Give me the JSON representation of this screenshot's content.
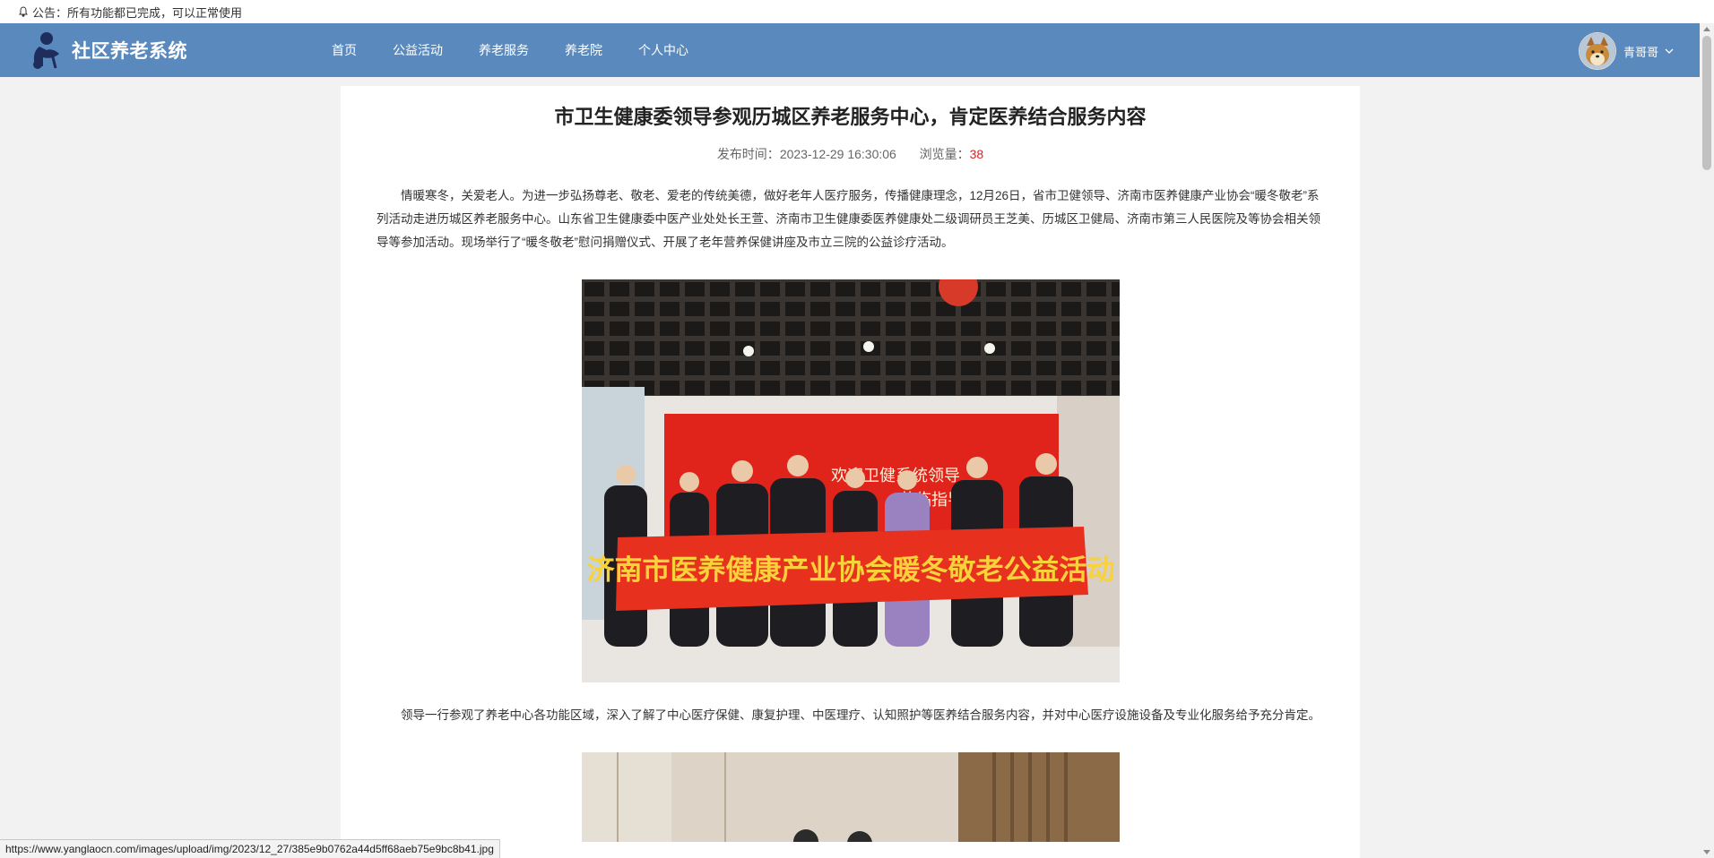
{
  "notice": {
    "text": "公告：所有功能都已完成，可以正常使用"
  },
  "navbar": {
    "brand": "社区养老系统",
    "links": [
      "首页",
      "公益活动",
      "养老服务",
      "养老院",
      "个人中心"
    ],
    "user_name": "青哥哥"
  },
  "article": {
    "title": "市卫生健康委领导参观历城区养老服务中心，肯定医养结合服务内容",
    "publish_label": "发布时间：",
    "publish_time": "2023-12-29 16:30:06",
    "views_label": "浏览量：",
    "views_count": "38",
    "paragraph1": "情暖寒冬，关爱老人。为进一步弘扬尊老、敬老、爱老的传统美德，做好老年人医疗服务，传播健康理念，12月26日，省市卫健领导、济南市医养健康产业协会“暖冬敬老”系列活动走进历城区养老服务中心。山东省卫生健康委中医产业处处长王萱、济南市卫生健康委医养健康处二级调研员王芝美、历城区卫健局、济南市第三人民医院及等协会相关领导等参加活动。现场举行了“暖冬敬老”慰问捐赠仪式、开展了老年营养保健讲座及市立三院的公益诊疗活动。",
    "photo1_banner_text": "济南市医养健康产业协会暖冬敬老公益活动",
    "photo1_wall_text_line1": "欢迎卫健系统领导",
    "photo1_wall_text_line2": "莅临指导",
    "paragraph2": "领导一行参观了养老中心各功能区域，深入了解了中心医疗保健、康复护理、中医理疗、认知照护等医养结合服务内容，并对中心医疗设施设备及专业化服务给予充分肯定。"
  },
  "status_bar": {
    "url": "https://www.yanglaocn.com/images/upload/img/2023/12_27/385e9b0762a44d5ff68aeb75e9bc8b41.jpg"
  },
  "colors": {
    "navbar": "#5a8abd",
    "views_count": "#e02020",
    "background": "#f2f2f2"
  }
}
